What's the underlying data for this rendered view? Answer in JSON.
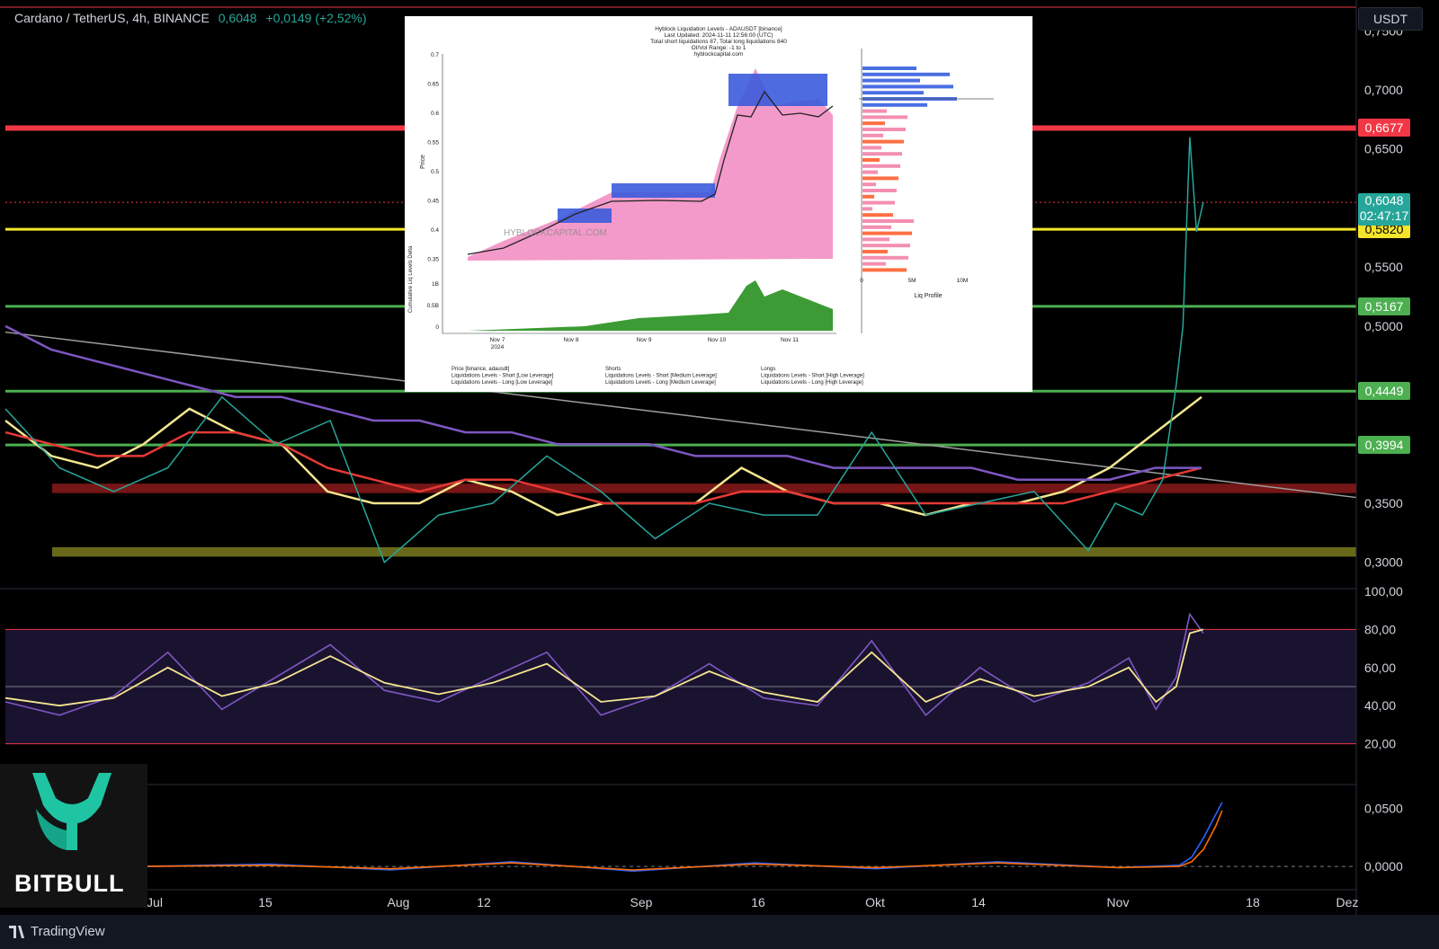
{
  "header": {
    "symbol": "Cardano / TetherUS, 4h, BINANCE",
    "price": "0,6048",
    "change": "+0,0149 (+2,52%)"
  },
  "currency_button": "USDT",
  "price_axis": {
    "ticks": [
      "0,7500",
      "0,7000",
      "0,6500",
      "0,5500",
      "0,5000",
      "0,3500",
      "0,3000"
    ],
    "tags": [
      {
        "label": "0,6677",
        "color": "#f23645",
        "value": 0.6677
      },
      {
        "label": "0,6048",
        "sublabel": "02:47:17",
        "color": "#26a69a",
        "value": 0.6048
      },
      {
        "label": "0,5820",
        "color": "#f5e52a",
        "value": 0.582
      },
      {
        "label": "0,5167",
        "color": "#4caf50",
        "value": 0.5167
      },
      {
        "label": "0,4449",
        "color": "#4caf50",
        "value": 0.4449
      },
      {
        "label": "0,3994",
        "color": "#4caf50",
        "value": 0.3994
      }
    ]
  },
  "rsi_axis": {
    "ticks": [
      "100,00",
      "80,00",
      "60,00",
      "40,00",
      "20,00"
    ]
  },
  "macd_axis": {
    "ticks": [
      "0,0500",
      "0,0000"
    ]
  },
  "time_axis": {
    "ticks": [
      "Jul",
      "15",
      "Aug",
      "12",
      "Sep",
      "16",
      "Okt",
      "14",
      "Nov",
      "18",
      "Dez"
    ]
  },
  "chart_data": [
    {
      "type": "line",
      "name": "price",
      "ylim": [
        0.28,
        0.77
      ],
      "x": [
        0,
        0.04,
        0.08,
        0.12,
        0.16,
        0.2,
        0.24,
        0.28,
        0.32,
        0.36,
        0.4,
        0.44,
        0.48,
        0.52,
        0.56,
        0.6,
        0.64,
        0.68,
        0.72,
        0.76,
        0.8,
        0.82,
        0.84,
        0.855,
        0.865,
        0.87,
        0.875,
        0.88,
        0.885
      ],
      "y": [
        0.43,
        0.38,
        0.36,
        0.38,
        0.44,
        0.4,
        0.42,
        0.3,
        0.34,
        0.35,
        0.39,
        0.36,
        0.32,
        0.35,
        0.34,
        0.34,
        0.41,
        0.34,
        0.35,
        0.36,
        0.31,
        0.35,
        0.34,
        0.37,
        0.45,
        0.5,
        0.66,
        0.58,
        0.6048
      ],
      "levels": [
        {
          "value": 0.6677,
          "color": "#f23645"
        },
        {
          "value": 0.582,
          "color": "#f5e52a"
        },
        {
          "value": 0.5167,
          "color": "#4caf50"
        },
        {
          "value": 0.4449,
          "color": "#4caf50"
        },
        {
          "value": 0.3994,
          "color": "#4caf50"
        }
      ],
      "zones": [
        {
          "from": 0.3586,
          "to": 0.3666,
          "color": "#8b1a1a"
        },
        {
          "from": 0.3048,
          "to": 0.3128,
          "color": "#7a7a1e"
        }
      ],
      "moving_averages": [
        {
          "color": "#f5e690",
          "y": [
            0.42,
            0.39,
            0.38,
            0.4,
            0.43,
            0.41,
            0.4,
            0.36,
            0.35,
            0.35,
            0.37,
            0.36,
            0.34,
            0.35,
            0.35,
            0.35,
            0.38,
            0.36,
            0.35,
            0.35,
            0.34,
            0.35,
            0.35,
            0.36,
            0.38,
            0.41,
            0.44
          ]
        },
        {
          "color": "#e53935",
          "y": [
            0.41,
            0.4,
            0.39,
            0.39,
            0.41,
            0.41,
            0.4,
            0.38,
            0.37,
            0.36,
            0.37,
            0.37,
            0.36,
            0.35,
            0.35,
            0.35,
            0.36,
            0.36,
            0.35,
            0.35,
            0.35,
            0.35,
            0.35,
            0.35,
            0.36,
            0.37,
            0.38
          ]
        },
        {
          "color": "#7e57c2",
          "y": [
            0.5,
            0.48,
            0.47,
            0.46,
            0.45,
            0.44,
            0.44,
            0.43,
            0.42,
            0.42,
            0.41,
            0.41,
            0.4,
            0.4,
            0.4,
            0.39,
            0.39,
            0.39,
            0.38,
            0.38,
            0.38,
            0.38,
            0.37,
            0.37,
            0.37,
            0.38,
            0.38
          ]
        }
      ]
    },
    {
      "type": "line",
      "name": "rsi",
      "ylim": [
        0,
        100
      ],
      "levels": [
        80,
        50,
        20
      ],
      "x": [
        0,
        0.04,
        0.08,
        0.12,
        0.16,
        0.2,
        0.24,
        0.28,
        0.32,
        0.36,
        0.4,
        0.44,
        0.48,
        0.52,
        0.56,
        0.6,
        0.64,
        0.68,
        0.72,
        0.76,
        0.8,
        0.83,
        0.85,
        0.865,
        0.875,
        0.885
      ],
      "y": [
        42,
        35,
        45,
        68,
        38,
        55,
        72,
        48,
        42,
        55,
        68,
        35,
        45,
        62,
        44,
        40,
        74,
        35,
        60,
        42,
        52,
        65,
        38,
        55,
        88,
        78
      ],
      "signal": [
        44,
        40,
        44,
        60,
        45,
        52,
        66,
        52,
        46,
        52,
        62,
        42,
        45,
        58,
        47,
        42,
        68,
        42,
        54,
        45,
        50,
        60,
        42,
        50,
        78,
        80
      ]
    },
    {
      "type": "line",
      "name": "macd",
      "ylim": [
        -0.02,
        0.065
      ],
      "x": [
        0,
        0.1,
        0.2,
        0.3,
        0.4,
        0.5,
        0.6,
        0.7,
        0.8,
        0.85,
        0.86,
        0.87,
        0.88,
        0.885
      ],
      "y": [
        0,
        0.002,
        -0.003,
        0.004,
        -0.004,
        0.003,
        -0.002,
        0.004,
        -0.001,
        0.001,
        0.008,
        0.025,
        0.045,
        0.055
      ],
      "signal": [
        0,
        0.001,
        -0.002,
        0.003,
        -0.003,
        0.002,
        -0.001,
        0.003,
        -0.001,
        0.0,
        0.004,
        0.015,
        0.035,
        0.048
      ]
    }
  ],
  "inset": {
    "title_lines": [
      "Hyblock Liquidation Levels - ADAUSDT [binance]",
      "Last Updated: 2024-11-11 12:56:00 (UTC)",
      "Total short liquidations 87, Total long liquidations 840",
      "OI/Vol Range: -1 to 1",
      "hyblockcapital.com"
    ],
    "watermark": "HYBLOCKCAPITAL.COM",
    "y_label": "Price",
    "y_ticks": [
      "0.7",
      "0.65",
      "0.6",
      "0.55",
      "0.5",
      "0.45",
      "0.4",
      "0.35"
    ],
    "x_ticks": [
      "Nov 7\n2024",
      "Nov 8",
      "Nov 9",
      "Nov 10",
      "Nov 11"
    ],
    "lower_label": "Cumulative Liq Levels Delta",
    "lower_ticks": [
      "1B",
      "0.5B",
      "0"
    ],
    "profile_ticks": [
      "0",
      "5M",
      "10M"
    ],
    "profile_label": "Liq Profile",
    "legend": [
      "Price [binance, adausdt]",
      "Shorts",
      "Longs",
      "Liquidations Levels - Short [Low Leverage]",
      "Liquidations Levels - Short [Medium Leverage]",
      "Liquidations Levels - Short [High Leverage]",
      "Liquidations Levels - Long [Low Leverage]",
      "Liquidations Levels - Long [Medium Leverage]",
      "Liquidations Levels - Long [High Leverage]"
    ]
  },
  "logo": {
    "text": "BITBULL"
  },
  "footer": {
    "brand": "TradingView"
  }
}
